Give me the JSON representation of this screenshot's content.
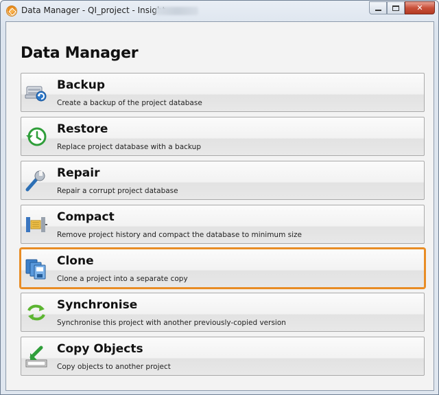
{
  "window": {
    "title": "Data Manager - QI_project - Insight",
    "close_glyph": "✕"
  },
  "page": {
    "title": "Data Manager"
  },
  "items": [
    {
      "label": "Backup",
      "description": "Create a backup of the project database",
      "icon": "backup-icon"
    },
    {
      "label": "Restore",
      "description": "Replace project database with a backup",
      "icon": "restore-icon"
    },
    {
      "label": "Repair",
      "description": "Repair a corrupt project database",
      "icon": "wrench-icon"
    },
    {
      "label": "Compact",
      "description": "Remove project history and compact the database to minimum size",
      "icon": "compact-icon"
    },
    {
      "label": "Clone",
      "description": "Clone a project into a separate copy",
      "icon": "clone-icon",
      "selected": true
    },
    {
      "label": "Synchronise",
      "description": "Synchronise this project with another previously-copied version",
      "icon": "sync-icon"
    },
    {
      "label": "Copy Objects",
      "description": "Copy objects to another project",
      "icon": "copy-objects-icon"
    }
  ],
  "colors": {
    "selection": "#e88c24"
  }
}
